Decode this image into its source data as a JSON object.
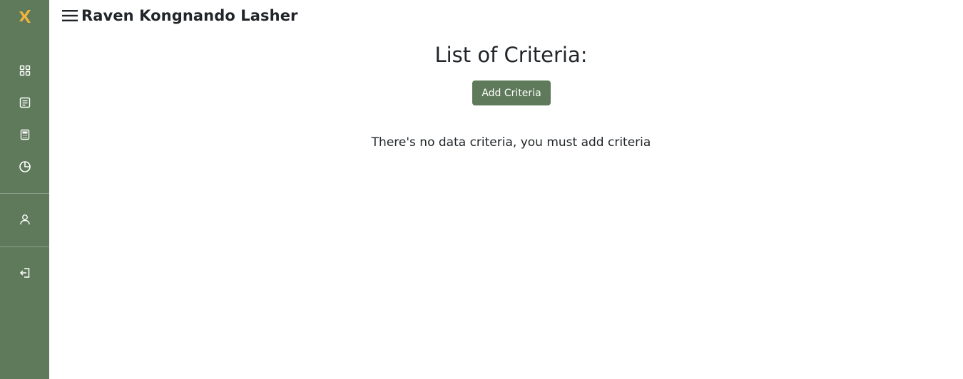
{
  "header": {
    "user_name": "Raven Kongnando Lasher"
  },
  "sidebar": {
    "logo_icon": "x-logo-icon",
    "items": [
      {
        "icon": "dashboard-icon"
      },
      {
        "icon": "document-icon"
      },
      {
        "icon": "calculator-icon"
      },
      {
        "icon": "pie-chart-icon"
      },
      {
        "icon": "user-icon"
      },
      {
        "icon": "logout-icon"
      }
    ]
  },
  "main": {
    "title": "List of Criteria:",
    "add_button_label": "Add Criteria",
    "empty_message": "There's no data criteria, you must add criteria"
  },
  "colors": {
    "sidebar_bg": "#5f7a5b",
    "logo_accent": "#f2b33d",
    "button_bg": "#5f7a5b",
    "text": "#212529"
  }
}
